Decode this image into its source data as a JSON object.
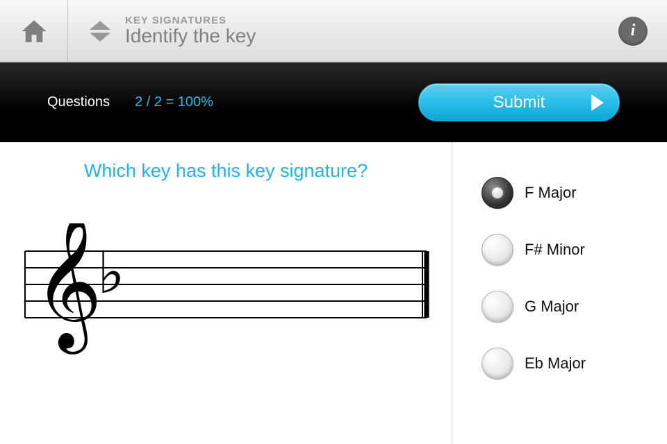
{
  "header": {
    "eyebrow": "KEY SIGNATURES",
    "title": "Identify the key"
  },
  "progress": {
    "label": "Questions",
    "score": "2 / 2 = 100%"
  },
  "submit_label": "Submit",
  "question": {
    "prompt": "Which key has this key signature?"
  },
  "answers": [
    {
      "label": "F Major",
      "selected": true
    },
    {
      "label": "F# Minor",
      "selected": false
    },
    {
      "label": "G Major",
      "selected": false
    },
    {
      "label": "Eb Major",
      "selected": false
    }
  ],
  "colors": {
    "accent": "#29bde8"
  }
}
